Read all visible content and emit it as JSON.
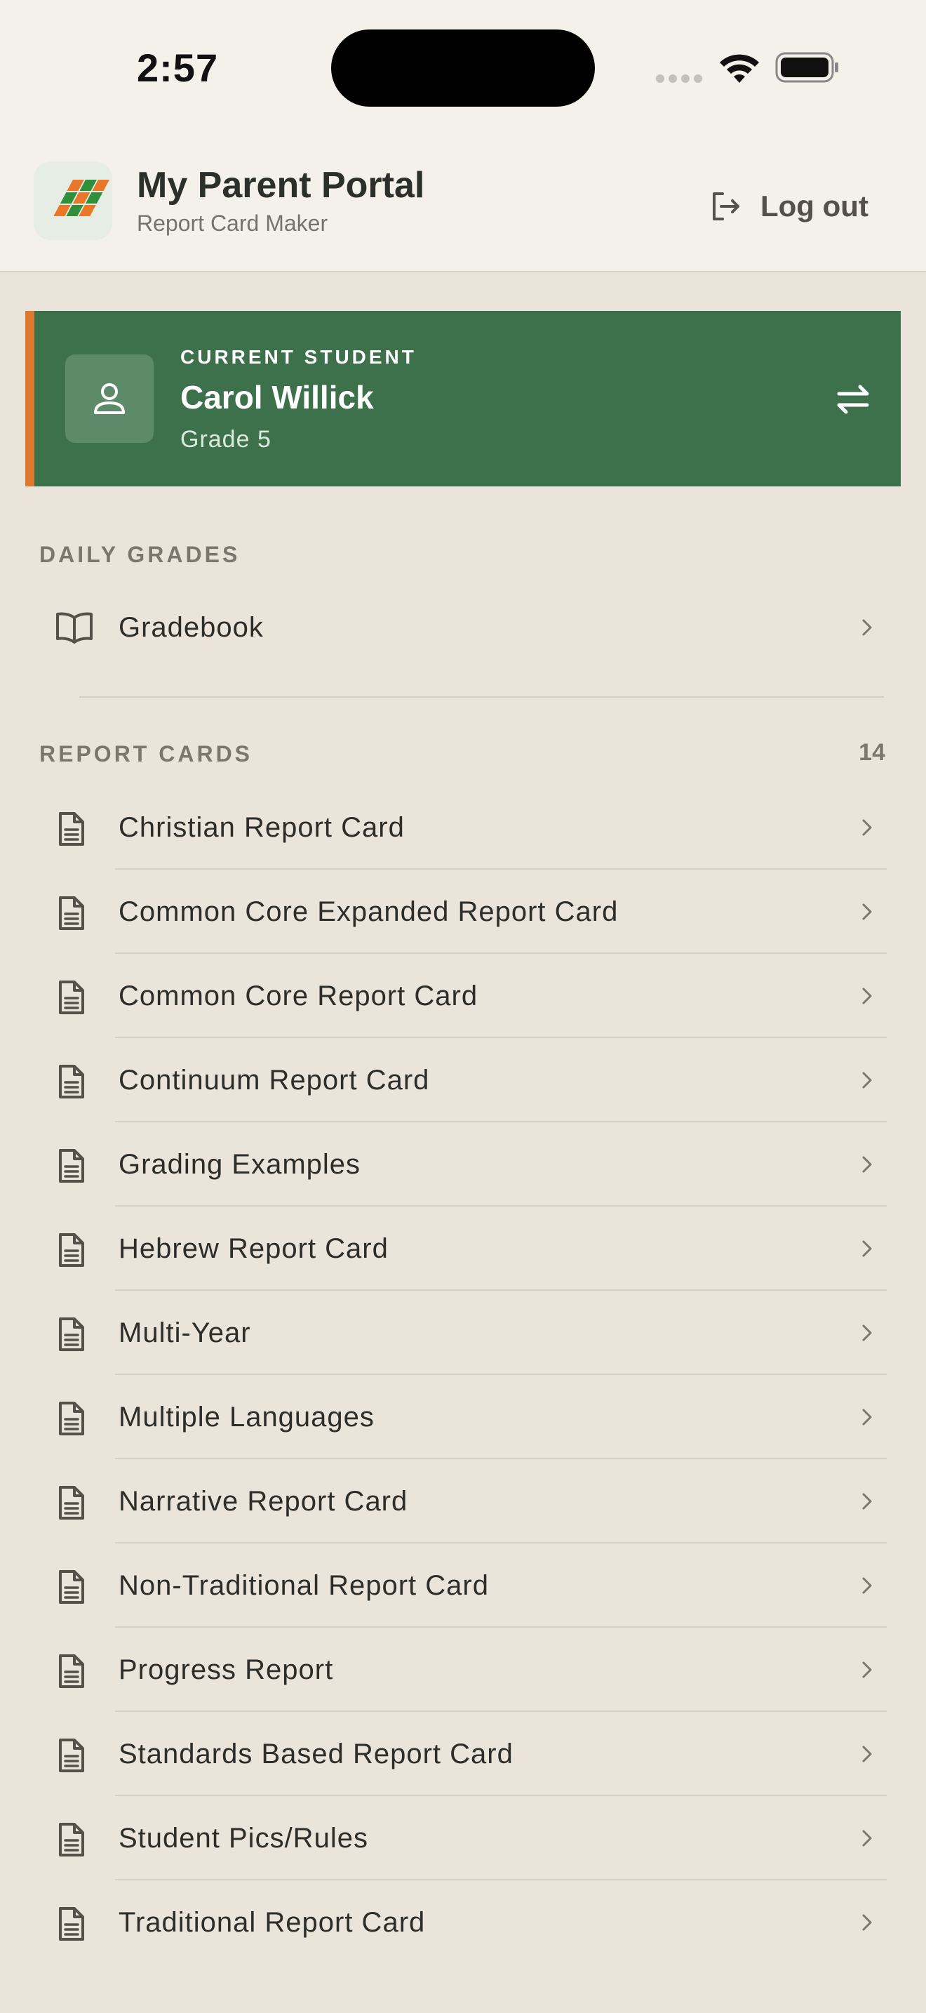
{
  "status_bar": {
    "time": "2:57"
  },
  "header": {
    "title": "My Parent Portal",
    "subtitle": "Report Card Maker",
    "logout_label": "Log out"
  },
  "current_student": {
    "eyebrow": "CURRENT STUDENT",
    "name": "Carol Willick",
    "grade": "Grade 5"
  },
  "daily_grades": {
    "section_label": "DAILY GRADES",
    "items": [
      {
        "label": "Gradebook",
        "icon": "book-open-icon"
      }
    ]
  },
  "report_cards": {
    "section_label": "REPORT CARDS",
    "count": "14",
    "items": [
      {
        "label": "Christian Report Card"
      },
      {
        "label": "Common Core Expanded Report Card"
      },
      {
        "label": "Common Core Report Card"
      },
      {
        "label": "Continuum Report Card"
      },
      {
        "label": "Grading Examples"
      },
      {
        "label": "Hebrew Report Card"
      },
      {
        "label": "Multi-Year"
      },
      {
        "label": "Multiple Languages"
      },
      {
        "label": "Narrative Report Card"
      },
      {
        "label": "Non-Traditional Report Card"
      },
      {
        "label": "Progress Report"
      },
      {
        "label": "Standards Based Report Card"
      },
      {
        "label": "Student Pics/Rules"
      },
      {
        "label": "Traditional Report Card"
      }
    ]
  },
  "colors": {
    "background": "#ebe4da",
    "header_bg": "#f4f0ea",
    "student_card": "#3d714b",
    "accent_orange": "#de7a2f",
    "text_primary": "#2d2d2a",
    "text_muted": "#7b776f"
  }
}
